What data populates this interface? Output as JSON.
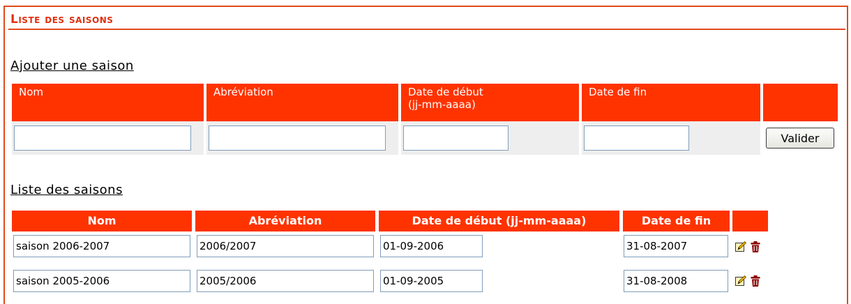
{
  "page": {
    "title": "Liste des saisons"
  },
  "add_section": {
    "heading": "Ajouter une saison",
    "columns": [
      {
        "label": "Nom"
      },
      {
        "label": "Abréviation"
      },
      {
        "label": "Date de début\n(jj-mm-aaaa)"
      },
      {
        "label": "Date de fin"
      },
      {
        "label": ""
      }
    ],
    "fields": {
      "nom": "",
      "abreviation": "",
      "date_debut": "",
      "date_fin": ""
    },
    "submit_label": "Valider"
  },
  "list_section": {
    "heading": "Liste des saisons",
    "columns": [
      {
        "label": "Nom"
      },
      {
        "label": "Abréviation"
      },
      {
        "label": "Date de début (jj-mm-aaaa)"
      },
      {
        "label": "Date de fin"
      },
      {
        "label": ""
      }
    ],
    "rows": [
      {
        "nom": "saison 2006-2007",
        "abreviation": "2006/2007",
        "date_debut": "01-09-2006",
        "date_fin": "31-08-2007"
      },
      {
        "nom": "saison 2005-2006",
        "abreviation": "2005/2006",
        "date_debut": "01-09-2005",
        "date_fin": "31-08-2008"
      }
    ],
    "row_actions": [
      "edit-icon",
      "delete-icon"
    ]
  },
  "colors": {
    "accent": "#ff3300",
    "title": "#e03010",
    "frame": "#e34a1a",
    "input_cell_bg": "#eeeeee"
  }
}
